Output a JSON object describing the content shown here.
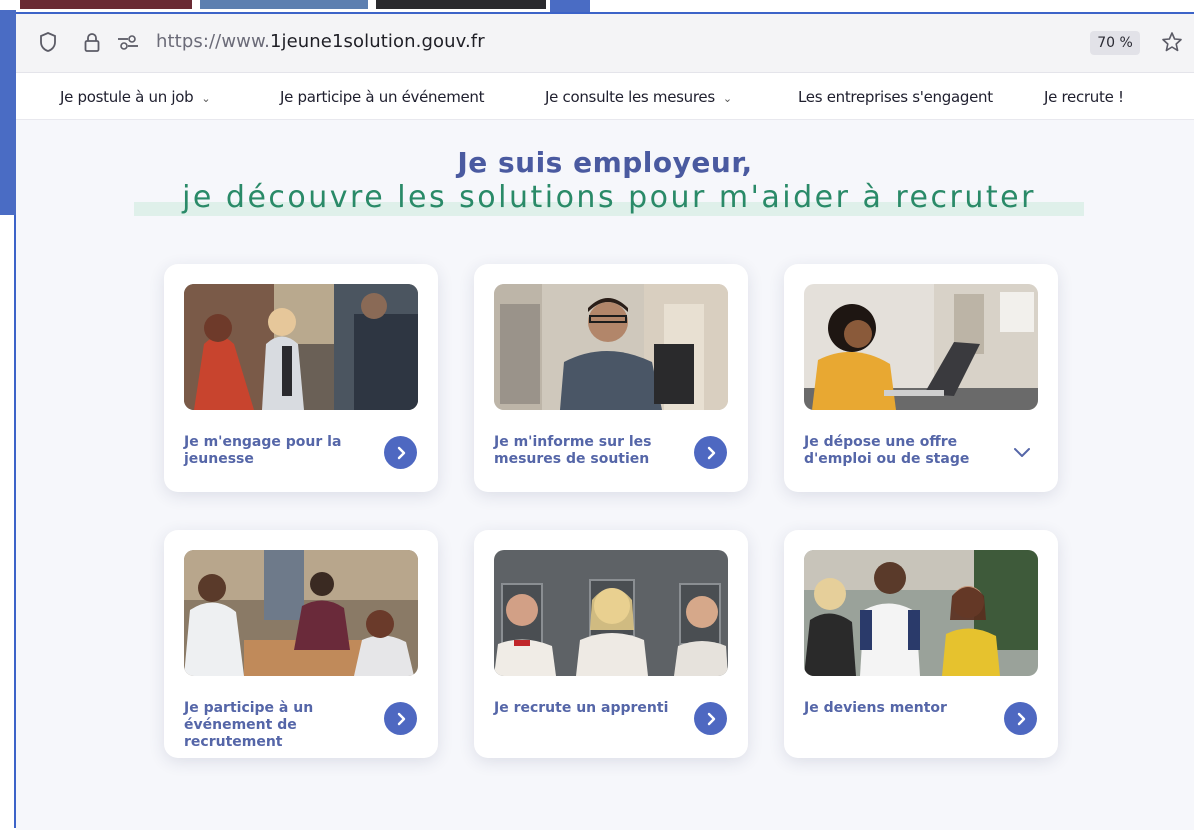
{
  "browser": {
    "url_prefix": "https://www.",
    "url_domain": "1jeune1solution.gouv.fr",
    "zoom": "70 %"
  },
  "nav": {
    "items": [
      {
        "label": "Je postule à un job",
        "has_dropdown": true
      },
      {
        "label": "Je participe à un événement",
        "has_dropdown": false
      },
      {
        "label": "Je consulte les mesures",
        "has_dropdown": true
      },
      {
        "label": "Les entreprises s'engagent",
        "has_dropdown": false
      },
      {
        "label": "Je recrute !",
        "has_dropdown": false
      }
    ]
  },
  "hero": {
    "title": "Je suis employeur,",
    "subtitle": "je découvre les solutions pour m'aider à recruter"
  },
  "cards": [
    {
      "label": "Je m'engage pour la jeunesse",
      "action": "arrow"
    },
    {
      "label": "Je m'informe sur les mesures de soutien",
      "action": "arrow"
    },
    {
      "label": "Je dépose une offre d'emploi ou de stage",
      "action": "chevron-down"
    },
    {
      "label": "Je participe à un événement de recrutement",
      "action": "arrow"
    },
    {
      "label": "Je recrute un apprenti",
      "action": "arrow"
    },
    {
      "label": "Je deviens mentor",
      "action": "arrow"
    }
  ],
  "colors": {
    "brand_blue": "#4a5aa0",
    "brand_green": "#2a8a68",
    "button_blue": "#4e68c1",
    "card_label": "#5566a8"
  }
}
